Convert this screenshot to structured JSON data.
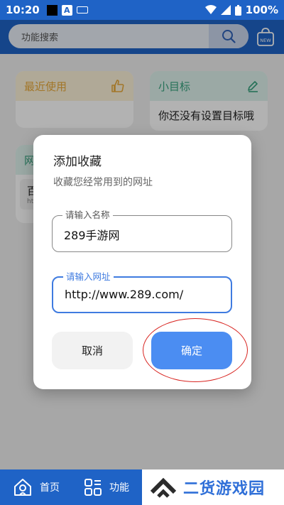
{
  "status_bar": {
    "time": "10:20",
    "a_glyph": "A",
    "battery": "100%"
  },
  "search": {
    "placeholder": "功能搜索"
  },
  "bag_badge": "NEW",
  "cards": {
    "recent": {
      "title": "最近使用"
    },
    "goal": {
      "title": "小目标",
      "text": "你还没有设置目标哦"
    },
    "partial": {
      "title": "网",
      "line1": "百",
      "line2": "ht"
    }
  },
  "dialog": {
    "title": "添加收藏",
    "subtitle": "收藏您经常用到的网址",
    "name_label": "请输入名称",
    "name_value": "289手游网",
    "url_label": "请输入网址",
    "url_value": "http://www.289.com/",
    "cancel_label": "取消",
    "ok_label": "确定"
  },
  "bottom_nav": {
    "home": "首页",
    "func": "功能"
  },
  "watermark": {
    "text": "二货游戏园"
  },
  "colors": {
    "brand": "#1f63c6",
    "accent": "#4b8df2",
    "annotation": "#d8231f"
  }
}
